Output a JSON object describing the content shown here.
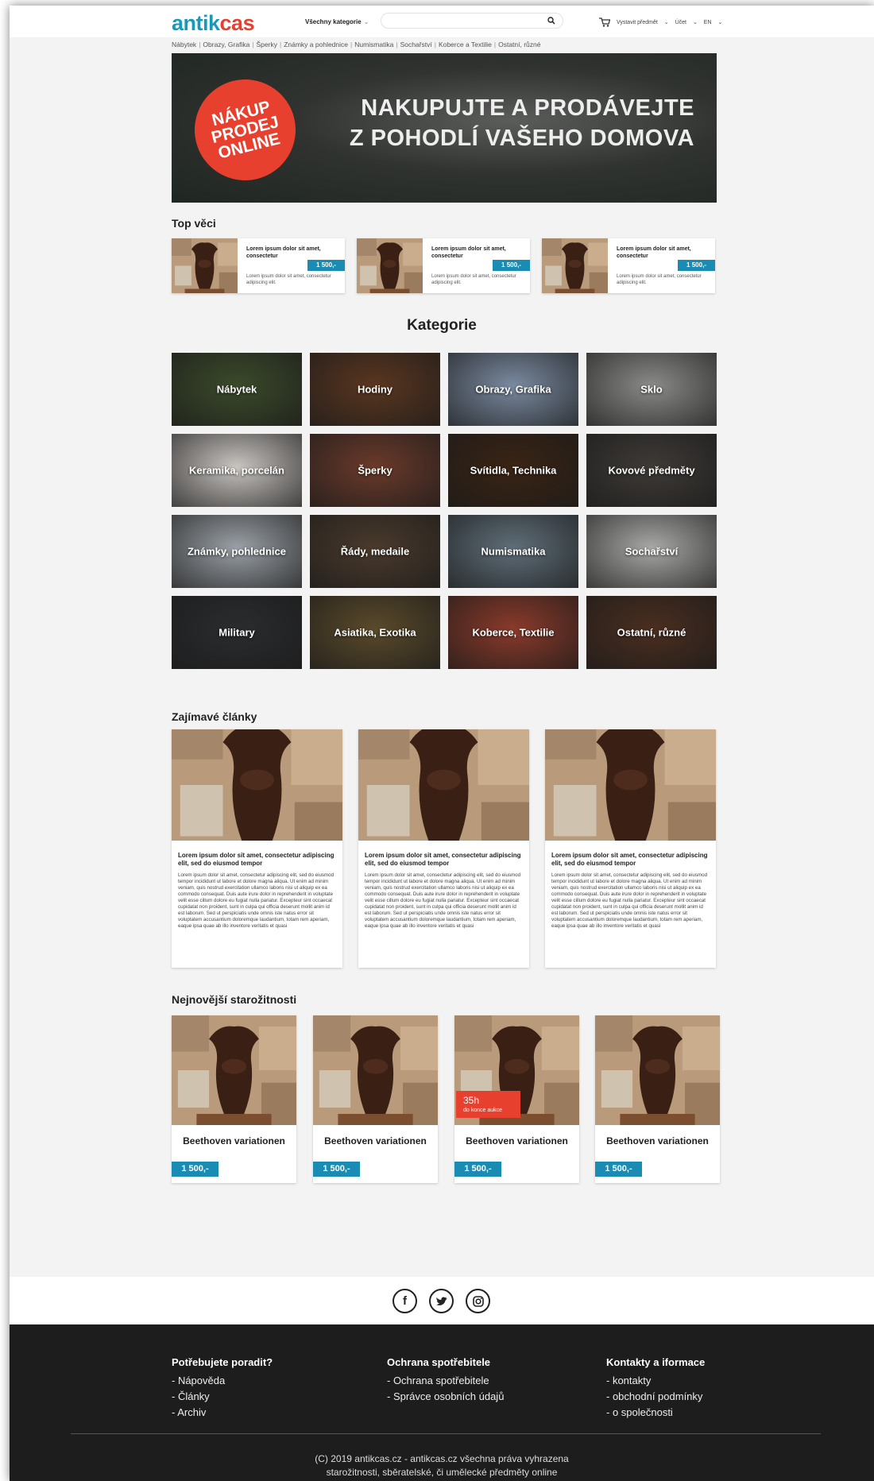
{
  "header": {
    "logo_part1": "antik",
    "logo_part2": "cas",
    "categories_label": "Všechny kategorie",
    "search_placeholder": "",
    "sell_label": "Vystavit předmět",
    "account_label": "Účet",
    "lang_label": "EN"
  },
  "topnav": [
    "Nábytek",
    "Obrazy, Grafika",
    "Šperky",
    "Známky a pohlednice",
    "Numismatika",
    "Sochařství",
    "Koberce a Textilie",
    "Ostatní, různé"
  ],
  "hero": {
    "badge_line1": "NÁKUP",
    "badge_line2": "PRODEJ",
    "badge_line3": "ONLINE",
    "title_line1": "NAKUPUJTE A PRODÁVEJTE",
    "title_line2": "Z POHODLÍ VAŠEHO DOMOVA"
  },
  "top_section": {
    "title": "Top věci",
    "items": [
      {
        "title": "Lorem ipsum dolor sit amet, consectetur",
        "price": "1 500,-",
        "desc": "Lorem ipsum dolor sit amet, consectetur adipiscing elit."
      },
      {
        "title": "Lorem ipsum dolor sit amet, consectetur",
        "price": "1 500,-",
        "desc": "Lorem ipsum dolor sit amet, consectetur adipiscing elit."
      },
      {
        "title": "Lorem ipsum dolor sit amet, consectetur",
        "price": "1 500,-",
        "desc": "Lorem ipsum dolor sit amet, consectetur adipiscing elit."
      }
    ]
  },
  "categories": {
    "title": "Kategorie",
    "items": [
      {
        "label": "Nábytek",
        "color": "#3b4a2a"
      },
      {
        "label": "Hodiny",
        "color": "#5a3620"
      },
      {
        "label": "Obrazy, Grafika",
        "color": "#7a8aa0"
      },
      {
        "label": "Sklo",
        "color": "#8a8a88"
      },
      {
        "label": "Keramika, porcelán",
        "color": "#c9c4c0"
      },
      {
        "label": "Šperky",
        "color": "#6a3a2a"
      },
      {
        "label": "Svítidla, Technika",
        "color": "#3a2414"
      },
      {
        "label": "Kovové předměty",
        "color": "#3e3a36"
      },
      {
        "label": "Známky, pohlednice",
        "color": "#9aa0a6"
      },
      {
        "label": "Řády, medaile",
        "color": "#4a3a2c"
      },
      {
        "label": "Numismatika",
        "color": "#5f6e78"
      },
      {
        "label": "Sochařství",
        "color": "#a8a8a6"
      },
      {
        "label": "Military",
        "color": "#2a2c2e"
      },
      {
        "label": "Asiatika, Exotika",
        "color": "#5a4a2a"
      },
      {
        "label": "Koberce, Textilie",
        "color": "#8a3a2a"
      },
      {
        "label": "Ostatní, různé",
        "color": "#4a2e20"
      }
    ]
  },
  "articles": {
    "title": "Zajímavé články",
    "items": [
      {
        "title": "Lorem ipsum dolor sit amet, consectetur adipiscing elit, sed do eiusmod tempor",
        "body": "Lorem ipsum dolor sit amet, consectetur adipiscing elit, sed do eiusmod tempor incididunt ut labore et dolore magna aliqua. Ut enim ad minim veniam, quis nostrud exercitation ullamco laboris nisi ut aliquip ex ea commodo consequat. Duis aute irure dolor in reprehenderit in voluptate velit esse cillum dolore eu fugiat nulla pariatur. Excepteur sint occaecat cupidatat non proident, sunt in culpa qui officia deserunt mollit anim id est laborum. Sed ut perspiciatis unde omnis iste natus error sit voluptatem accusantium doloremque laudantium, totam rem aperiam, eaque ipsa quae ab illo inventore veritatis et quasi"
      },
      {
        "title": "Lorem ipsum dolor sit amet, consectetur adipiscing elit, sed do eiusmod tempor",
        "body": "Lorem ipsum dolor sit amet, consectetur adipiscing elit, sed do eiusmod tempor incididunt ut labore et dolore magna aliqua. Ut enim ad minim veniam, quis nostrud exercitation ullamco laboris nisi ut aliquip ex ea commodo consequat. Duis aute irure dolor in reprehenderit in voluptate velit esse cillum dolore eu fugiat nulla pariatur. Excepteur sint occaecat cupidatat non proident, sunt in culpa qui officia deserunt mollit anim id est laborum. Sed ut perspiciatis unde omnis iste natus error sit voluptatem accusantium doloremque laudantium, totam rem aperiam, eaque ipsa quae ab illo inventore veritatis et quasi"
      },
      {
        "title": "Lorem ipsum dolor sit amet, consectetur adipiscing elit, sed do eiusmod tempor",
        "body": "Lorem ipsum dolor sit amet, consectetur adipiscing elit, sed do eiusmod tempor incididunt ut labore et dolore magna aliqua. Ut enim ad minim veniam, quis nostrud exercitation ullamco laboris nisi ut aliquip ex ea commodo consequat. Duis aute irure dolor in reprehenderit in voluptate velit esse cillum dolore eu fugiat nulla pariatur. Excepteur sint occaecat cupidatat non proident, sunt in culpa qui officia deserunt mollit anim id est laborum. Sed ut perspiciatis unde omnis iste natus error sit voluptatem accusantium doloremque laudantium, totam rem aperiam, eaque ipsa quae ab illo inventore veritatis et quasi"
      }
    ]
  },
  "newest": {
    "title": "Nejnovější starožitnosti",
    "items": [
      {
        "name": "Beethoven variationen",
        "price": "1 500,-"
      },
      {
        "name": "Beethoven variationen",
        "price": "1 500,-"
      },
      {
        "name": "Beethoven variationen",
        "price": "1 500,-",
        "auction_hours": "35h",
        "auction_text": "do konce aukce"
      },
      {
        "name": "Beethoven variationen",
        "price": "1 500,-"
      }
    ]
  },
  "social": {
    "facebook": "f",
    "twitter": "twitter-icon",
    "instagram": "instagram-icon"
  },
  "footer": {
    "col1": {
      "title": "Potřebujete poradit?",
      "links": [
        "- Nápověda",
        "- Články",
        "- Archiv"
      ]
    },
    "col2": {
      "title": "Ochrana spotřebitele",
      "links": [
        "- Ochrana spotřebitele",
        "- Správce osobních údajů"
      ]
    },
    "col3": {
      "title": "Kontakty a iformace",
      "links": [
        "- kontakty",
        "- obchodní podmínky",
        "- o společnosti"
      ]
    },
    "copyright_line1": "(C) 2019 antikcas.cz - antikcas.cz všechna práva vyhrazena",
    "copyright_line2": "starožitnosti, sběratelské, či umělecké předměty online"
  },
  "colors": {
    "brand_blue": "#1799b9",
    "brand_red": "#e8402f",
    "price_blue": "#1a8cb3",
    "footer_bg": "#1d1d1d"
  }
}
